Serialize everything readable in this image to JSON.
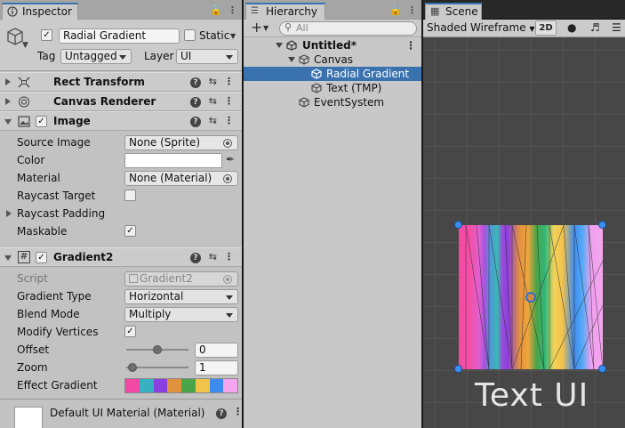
{
  "inspector": {
    "tab_label": "Inspector",
    "object_name": "Radial Gradient",
    "static_label": "Static",
    "tag_label": "Tag",
    "tag_value": "Untagged",
    "layer_label": "Layer",
    "layer_value": "UI",
    "components": {
      "rect_transform": "Rect Transform",
      "canvas_renderer": "Canvas Renderer",
      "image": "Image",
      "gradient2": "Gradient2"
    },
    "image_props": {
      "source_image_label": "Source Image",
      "source_image_value": "None (Sprite)",
      "color_label": "Color",
      "material_label": "Material",
      "material_value": "None (Material)",
      "raycast_target_label": "Raycast Target",
      "raycast_padding_label": "Raycast Padding",
      "maskable_label": "Maskable"
    },
    "gradient_props": {
      "script_label": "Script",
      "script_value": "Gradient2",
      "gradient_type_label": "Gradient Type",
      "gradient_type_value": "Horizontal",
      "blend_mode_label": "Blend Mode",
      "blend_mode_value": "Multiply",
      "modify_vertices_label": "Modify Vertices",
      "offset_label": "Offset",
      "offset_value": "0",
      "offset_slider_fraction": 0.5,
      "zoom_label": "Zoom",
      "zoom_value": "1",
      "zoom_slider_fraction": 0.1,
      "effect_gradient_label": "Effect Gradient",
      "effect_gradient_colors": [
        "#f24aa4",
        "#37b0c0",
        "#8a3fe0",
        "#e2913e",
        "#4aa448",
        "#f2c34b",
        "#3f8cf0",
        "#f5a6ee"
      ]
    },
    "material_footer": "Default UI Material (Material)"
  },
  "hierarchy": {
    "tab_label": "Hierarchy",
    "search_placeholder": "All",
    "add_label": "+",
    "items": [
      {
        "label": "Untitled*"
      },
      {
        "label": "Canvas"
      },
      {
        "label": "Radial Gradient"
      },
      {
        "label": "Text (TMP)"
      },
      {
        "label": "EventSystem"
      }
    ]
  },
  "scene": {
    "tab_label": "Scene",
    "shading_mode": "Shaded Wireframe",
    "mode_2d": "2D",
    "text_ui": "Text UI"
  },
  "colors": {
    "selection": "#3a72b0",
    "handle": "#3a8ef0"
  }
}
